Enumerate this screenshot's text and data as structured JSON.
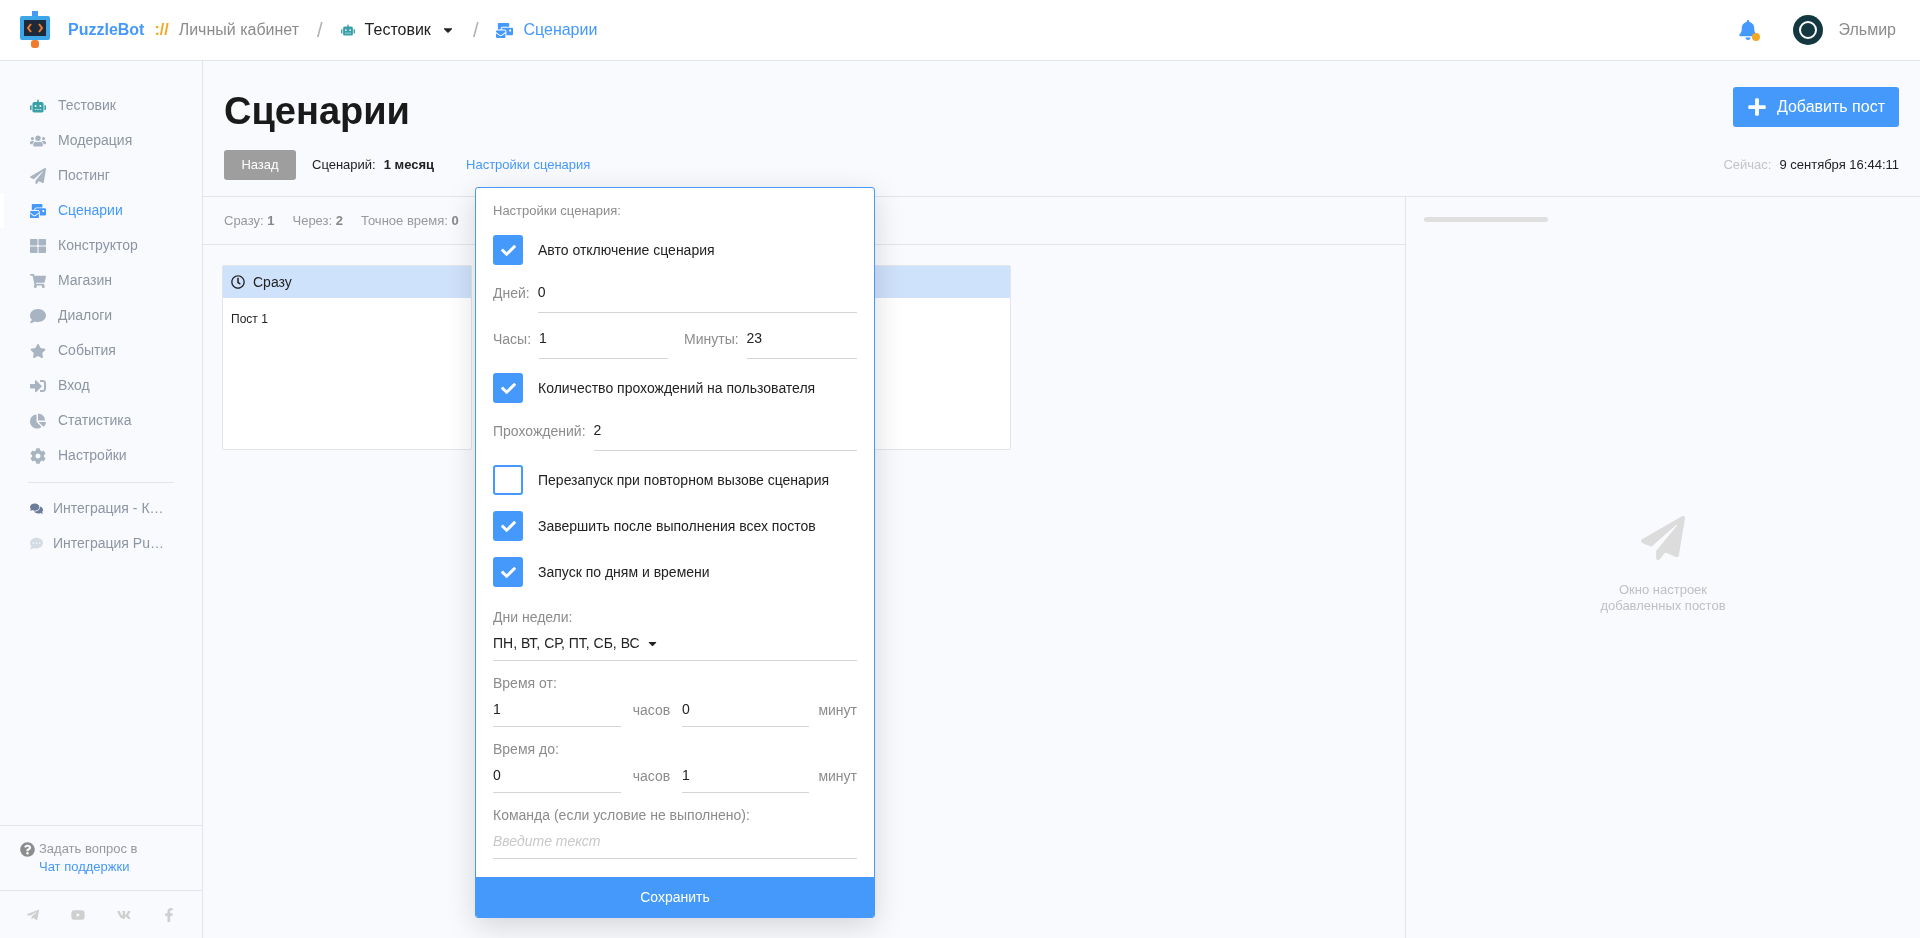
{
  "header": {
    "brand": "PuzzleBot",
    "brand_suffix": "://",
    "separator": "/",
    "breadcrumbs": [
      {
        "kind": "link",
        "label": "Личный кабинет"
      },
      {
        "kind": "bot",
        "label": "Тестовик"
      },
      {
        "kind": "current",
        "label": "Сценарии"
      }
    ],
    "user": "Эльмир"
  },
  "sidebar": {
    "items": [
      {
        "label": "Тестовик",
        "selected": false
      },
      {
        "label": "Модерация",
        "selected": false
      },
      {
        "label": "Постинг",
        "selected": false
      },
      {
        "label": "Сценарии",
        "selected": true
      },
      {
        "label": "Конструктор",
        "selected": false
      },
      {
        "label": "Магазин",
        "selected": false
      },
      {
        "label": "Диалоги",
        "selected": false
      },
      {
        "label": "События",
        "selected": false
      },
      {
        "label": "Вход",
        "selected": false
      },
      {
        "label": "Статистика",
        "selected": false
      },
      {
        "label": "Настройки",
        "selected": false
      }
    ],
    "integrations": [
      {
        "label": "Интеграция - К…"
      },
      {
        "label": "Интеграция Pu…"
      }
    ],
    "help": {
      "text": "Задать вопрос в",
      "link": "Чат поддержки"
    }
  },
  "main": {
    "title": "Сценарии",
    "add_button": "Добавить пост",
    "back_button": "Назад",
    "scenario_label": "Сценарий:",
    "scenario_name": "1 месяц",
    "settings_link": "Настройки сценария",
    "now_label": "Сейчас:",
    "now_value": "9 сентября 16:44:11",
    "stats": [
      "Сразу: **1**",
      "Через: **2**",
      "Точное время: **0**"
    ],
    "cards": [
      {
        "title": "Сразу",
        "posts": [
          "Пост 1"
        ]
      }
    ],
    "side_panel_text": "Окно настроек добавленных постов"
  },
  "settings_popup": {
    "title": "Настройки сценария:",
    "rows": [
      {
        "kind": "checkbox",
        "label": "Авто отключение сценария",
        "checked": true
      },
      {
        "kind": "field",
        "label": "Дней:",
        "value": "0"
      },
      {
        "kind": "pair",
        "fields": [
          {
            "label": "Часы:",
            "value": "1"
          },
          {
            "label": "Минуты:",
            "value": "23"
          }
        ]
      },
      {
        "kind": "checkbox",
        "label": "Количество прохождений на пользователя",
        "checked": true
      },
      {
        "kind": "field",
        "label": "Прохождений:",
        "value": "2"
      },
      {
        "kind": "checkbox",
        "label": "Перезапуск при повторном вызове сценария",
        "checked": false
      },
      {
        "kind": "checkbox",
        "label": "Завершить после выполнения всех постов",
        "checked": true
      },
      {
        "kind": "checkbox",
        "label": "Запуск по дням и времени",
        "checked": true
      },
      {
        "kind": "select",
        "label": "Дни недели:",
        "value": "ПН, ВТ, СР, ПТ, СБ, ВС"
      },
      {
        "kind": "time",
        "label": "Время от:",
        "hours": "1",
        "hours_unit": "часов",
        "minutes": "0",
        "minutes_unit": "минут"
      },
      {
        "kind": "time",
        "label": "Время до:",
        "hours": "0",
        "hours_unit": "часов",
        "minutes": "1",
        "minutes_unit": "минут"
      },
      {
        "kind": "text",
        "label": "Команда (если условие не выполнено):",
        "placeholder": "Введите текст"
      }
    ],
    "save_button": "Сохранить"
  }
}
